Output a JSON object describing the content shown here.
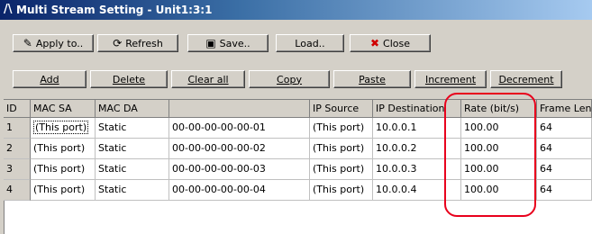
{
  "window": {
    "title": "Multi Stream Setting - Unit1:3:1",
    "icon": "logo-icon"
  },
  "toolbar": {
    "apply": "Apply to..",
    "refresh": "Refresh",
    "save": "Save..",
    "load": "Load..",
    "close": "Close"
  },
  "actions": {
    "add": "Add",
    "delete": "Delete",
    "clear_all": "Clear all",
    "copy": "Copy",
    "paste": "Paste",
    "increment": "Increment",
    "decrement": "Decrement"
  },
  "table": {
    "columns": [
      "ID",
      "MAC SA",
      "MAC DA",
      "",
      "IP Source",
      "IP Destination",
      "Rate (bit/s)",
      "Frame Len"
    ],
    "rows": [
      [
        "1",
        "(This port)",
        "Static",
        "00-00-00-00-00-01",
        "(This port)",
        "10.0.0.1",
        "100.00",
        "64"
      ],
      [
        "2",
        "(This port)",
        "Static",
        "00-00-00-00-00-02",
        "(This port)",
        "10.0.0.2",
        "100.00",
        "64"
      ],
      [
        "3",
        "(This port)",
        "Static",
        "00-00-00-00-00-03",
        "(This port)",
        "10.0.0.3",
        "100.00",
        "64"
      ],
      [
        "4",
        "(This port)",
        "Static",
        "00-00-00-00-00-04",
        "(This port)",
        "10.0.0.4",
        "100.00",
        "64"
      ]
    ]
  },
  "colors": {
    "highlight": "#e8001c",
    "title_gradient_start": "#0a246a"
  }
}
